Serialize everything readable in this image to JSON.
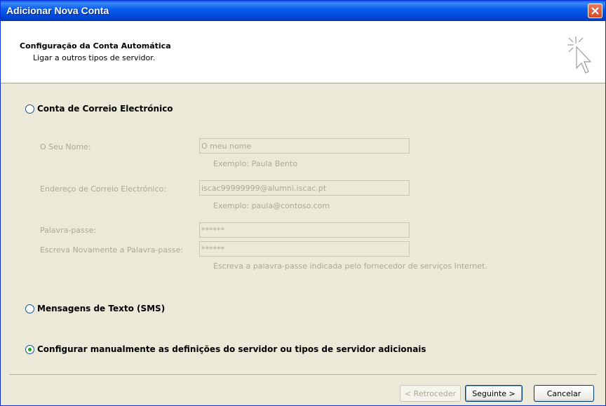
{
  "window": {
    "title": "Adicionar Nova Conta"
  },
  "header": {
    "title": "Configuração da Conta Automática",
    "subtitle": "Ligar a outros tipos de servidor."
  },
  "options": {
    "email": "Conta de Correio Electrónico",
    "sms": "Mensagens de Texto (SMS)",
    "manual": "Configurar manualmente as definições do servidor ou tipos de servidor adicionais",
    "selected": "manual"
  },
  "form": {
    "name_label": "O Seu Nome:",
    "name_value": "O meu nome",
    "name_hint": "Exemplo: Paula Bento",
    "email_label": "Endereço de Correio Electrónico:",
    "email_value": "iscac99999999@alumni.iscac.pt",
    "email_hint": "Exemplo: paula@contoso.com",
    "password_label": "Palavra-passe:",
    "password_value": "******",
    "password2_label": "Escreva Novamente a Palavra-passe:",
    "password2_value": "******",
    "password_hint": "Escreva a palavra-passe indicada pelo fornecedor de serviços Internet."
  },
  "buttons": {
    "back": "< Retroceder",
    "next": "Seguinte >",
    "cancel": "Cancelar"
  },
  "colors": {
    "titlebar": "#0a5ff0",
    "disabled_text": "#aca899",
    "radio_dot": "#21a121"
  }
}
